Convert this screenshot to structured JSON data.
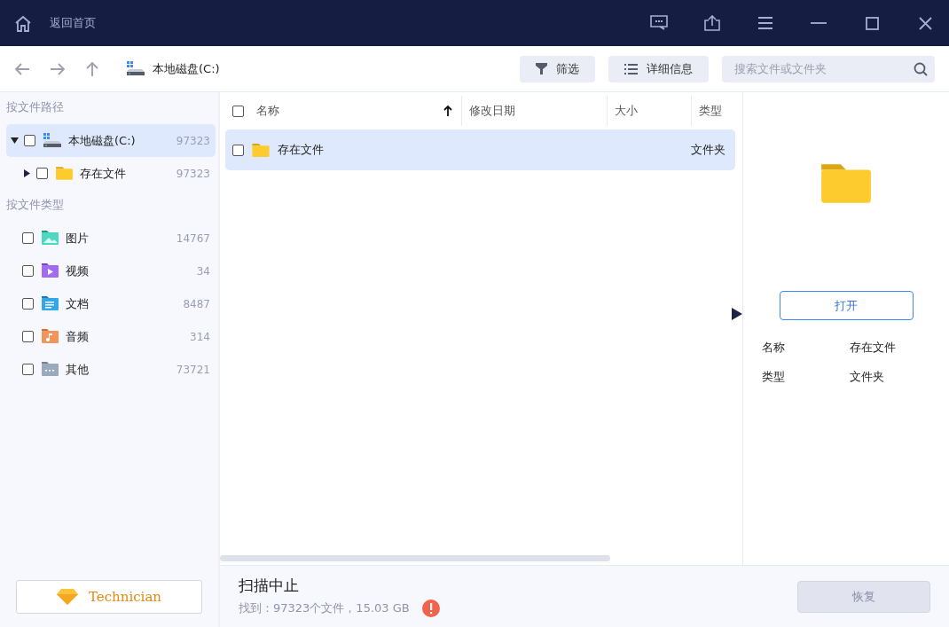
{
  "title_bar": {
    "home_label": "返回首页"
  },
  "toolbar": {
    "location": "本地磁盘(C:)",
    "filter_button": "筛选",
    "details_button": "详细信息",
    "search": {
      "placeholder": "搜索文件或文件夹"
    }
  },
  "sidebar": {
    "path_heading": "按文件路径",
    "tree": [
      {
        "label": "本地磁盘(C:)",
        "count": "97323",
        "kind": "disk",
        "expanded": true,
        "selected": true,
        "checked": false,
        "children": [
          {
            "label": "存在文件",
            "count": "97323",
            "kind": "folder",
            "expanded": false,
            "selected": false,
            "checked": false
          }
        ]
      }
    ],
    "type_heading": "按文件类型",
    "types": [
      {
        "label": "图片",
        "count": "14767",
        "kind": "image",
        "checked": false
      },
      {
        "label": "视频",
        "count": "34",
        "kind": "video",
        "checked": false
      },
      {
        "label": "文档",
        "count": "8487",
        "kind": "document",
        "checked": false
      },
      {
        "label": "音频",
        "count": "314",
        "kind": "audio",
        "checked": false
      },
      {
        "label": "其他",
        "count": "73721",
        "kind": "other",
        "checked": false
      }
    ],
    "upgrade_button": "Technician"
  },
  "table": {
    "columns": [
      "名称",
      "修改日期",
      "大小",
      "类型"
    ],
    "header_checked": false,
    "rows": [
      {
        "name": "存在文件",
        "type": "文件夹",
        "selected": true,
        "checked": false
      }
    ]
  },
  "details": {
    "open_button": "打开",
    "fields": [
      {
        "label": "名称",
        "value": "存在文件"
      },
      {
        "label": "类型",
        "value": "文件夹"
      }
    ]
  },
  "status_bar": {
    "title": "扫描中止",
    "summary": "找到：97323个文件，15.03 GB",
    "recover_button": "恢复",
    "recover_disabled": true
  }
}
